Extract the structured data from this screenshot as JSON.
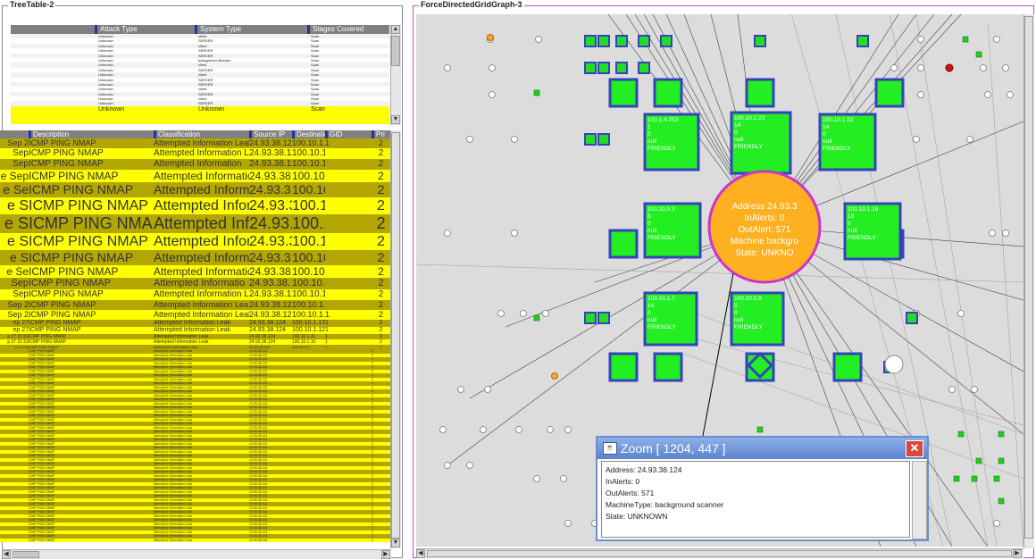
{
  "panels": {
    "left_title": "TreeTable-2",
    "right_title": "ForceDirectedGridGraph-3"
  },
  "top_table": {
    "headers": [
      "Attack Type",
      "System Type",
      "Stages Covered"
    ],
    "rows": [
      {
        "attack": "Unknown",
        "system": "client",
        "stages": "Scan"
      },
      {
        "attack": "Unknown",
        "system": "SERVER",
        "stages": "Scan"
      },
      {
        "attack": "Unknown",
        "system": "client",
        "stages": "Scan"
      },
      {
        "attack": "Unknown",
        "system": "SERVER",
        "stages": "Scan"
      },
      {
        "attack": "Unknown",
        "system": "SERVER",
        "stages": "Scan"
      },
      {
        "attack": "Unknown",
        "system": "background attacker",
        "stages": "Scan"
      },
      {
        "attack": "Unknown",
        "system": "client",
        "stages": "Scan"
      },
      {
        "attack": "Unknown",
        "system": "SERVER",
        "stages": "Scan"
      },
      {
        "attack": "Unknown",
        "system": "client",
        "stages": "Scan"
      },
      {
        "attack": "Unknown",
        "system": "SERVER",
        "stages": "Scan"
      },
      {
        "attack": "Unknown",
        "system": "SERVER",
        "stages": "Scan"
      },
      {
        "attack": "Unknown",
        "system": "client",
        "stages": "Scan"
      },
      {
        "attack": "Unknown",
        "system": "SERVER",
        "stages": "Scan"
      },
      {
        "attack": "Unknown",
        "system": "client",
        "stages": "Scan"
      },
      {
        "attack": "Unknown",
        "system": "SERVER",
        "stages": "Scan"
      },
      {
        "attack": "Unknown",
        "system": "Unknown",
        "stages": "Scan"
      }
    ]
  },
  "bottom_table": {
    "headers": [
      "Description",
      "Classification",
      "Source IP",
      "Destination",
      "GID",
      "Pri"
    ],
    "rows": [
      {
        "date": "Sep 2",
        "desc": "ICMP PING NMAP",
        "cls": "Attempted Information Leak",
        "src": "24.93.38.12",
        "dst": "100.10.1.1",
        "gid": "1",
        "pri": "2",
        "size": 9,
        "bg": "ol"
      },
      {
        "date": "Sep",
        "desc": "ICMP PING NMAP",
        "cls": "Attempted Information L",
        "src": "24.93.38.11",
        "dst": "100.10.1.21",
        "gid": "",
        "pri": "2",
        "size": 10,
        "bg": "yel"
      },
      {
        "date": "Sep",
        "desc": "ICMP PING NMAP",
        "cls": "Attempted Information",
        "src": "24.93.38.11",
        "dst": "100.10.1.31",
        "gid": "",
        "pri": "2",
        "size": 10,
        "bg": "ol"
      },
      {
        "date": "e Sep",
        "desc": "ICMP PING NMAP",
        "cls": "Attempted Informatio",
        "src": "24.93.38.",
        "dst": "100.10.1.1",
        "gid": "",
        "pri": "2",
        "size": 12,
        "bg": "yel"
      },
      {
        "date": "e Se",
        "desc": "ICMP PING NMAP",
        "cls": "Attempted Inform",
        "src": "24.93.3",
        "dst": "100.10.1",
        "gid": "",
        "pri": "2",
        "size": 14,
        "bg": "ol"
      },
      {
        "date": "e S",
        "desc": "ICMP PING NMAP",
        "cls": "Attempted Infor",
        "src": "24.93.3",
        "dst": "100.10.1",
        "gid": "",
        "pri": "2",
        "size": 16,
        "bg": "yel"
      },
      {
        "date": "e S",
        "desc": "ICMP PING NMAP",
        "cls": "Attempted Infor",
        "src": "24.93.3",
        "dst": "100.10.1",
        "gid": "",
        "pri": "2",
        "size": 18,
        "bg": "ol"
      },
      {
        "date": "e S",
        "desc": "ICMP PING NMAP",
        "cls": "Attempted Infor",
        "src": "24.93.3",
        "dst": "100.10.1",
        "gid": "",
        "pri": "2",
        "size": 16,
        "bg": "yel"
      },
      {
        "date": "e S",
        "desc": "ICMP PING NMAP",
        "cls": "Attempted Inform",
        "src": "24.93.3",
        "dst": "100.10.1",
        "gid": "",
        "pri": "2",
        "size": 14,
        "bg": "ol"
      },
      {
        "date": "e Se",
        "desc": "ICMP PING NMAP",
        "cls": "Attempted Informatio",
        "src": "24.93.38.",
        "dst": "100.10.1.1",
        "gid": "",
        "pri": "2",
        "size": 12,
        "bg": "yel"
      },
      {
        "date": "Sep",
        "desc": "ICMP PING NMAP",
        "cls": "Attempted Informatio",
        "src": "24.93.38.",
        "dst": "100.10.1.1",
        "gid": "",
        "pri": "2",
        "size": 11,
        "bg": "ol"
      },
      {
        "date": "Sep",
        "desc": "ICMP PING NMAP",
        "cls": "Attempted Information L",
        "src": "24.93.38.11",
        "dst": "100.10.1.11",
        "gid": "",
        "pri": "2",
        "size": 10,
        "bg": "yel"
      },
      {
        "date": "Sep 2",
        "desc": "ICMP PING NMAP",
        "cls": "Attempted Information Lea",
        "src": "24.93.38.12",
        "dst": "100.10.1.31",
        "gid": "",
        "pri": "2",
        "size": 9,
        "bg": "ol"
      },
      {
        "date": "Sep 2",
        "desc": "ICMP PING NMAP",
        "cls": "Attempted Information Leak",
        "src": "24.93.38.12",
        "dst": "100.10.1.14",
        "gid": "1",
        "pri": "2",
        "size": 9,
        "bg": "yel"
      },
      {
        "date": "ep 27",
        "desc": "ICMP PING NMAP",
        "cls": "Attempted Information Leak",
        "src": "24.93.38.124",
        "dst": "100.10.1.13",
        "gid": "1",
        "pri": "2",
        "size": 7,
        "bg": "ol"
      },
      {
        "date": "ep 27",
        "desc": "ICMP PING NMAP",
        "cls": "Attempted Information Leak",
        "src": "24.93.38.124",
        "dst": "100.10.1.12",
        "gid": "1",
        "pri": "2",
        "size": 7,
        "bg": "yel"
      },
      {
        "date": "p 27 21:53",
        "desc": "ICMP PING NMAP",
        "cls": "Attempted Information Leak",
        "src": "24.93.38.124",
        "dst": "100.10.1.11",
        "gid": "1",
        "pri": "2",
        "size": 5,
        "bg": "ol"
      },
      {
        "date": "p 27 21:53",
        "desc": "ICMP PING NMAP",
        "cls": "Attempted Information Leak",
        "src": "24.93.38.124",
        "dst": "100.10.1.10",
        "gid": "1",
        "pri": "2",
        "size": 5,
        "bg": "yel"
      },
      {
        "date": "27 21:53",
        "desc": "ICMP PING NMAP",
        "cls": "Attempted Information Leak",
        "src": "24.93.38.124",
        "dst": "100.10.1.9",
        "gid": "1",
        "pri": "2",
        "size": 4,
        "bg": "ol"
      }
    ],
    "tiny_desc": "ICMP PING NMAP",
    "tiny_cls": "Attempted Information Leak",
    "tiny_src": "24.93.38.124",
    "tiny_pri": "2"
  },
  "graph": {
    "hub": {
      "lines": [
        "Address 24.93.3",
        "InAlerts: 0",
        "OutAlert: 571",
        "Machine backgro",
        "State: UNKNO"
      ]
    },
    "boxes": [
      {
        "lines": [
          "100.1.4.253",
          "1",
          "0",
          "null",
          "FRIENDLY"
        ]
      },
      {
        "lines": [
          "100.10.1.23",
          "14",
          "0",
          "null",
          "FRIENDLY"
        ]
      },
      {
        "lines": [
          "100.10.1.22",
          "14",
          "0",
          "null",
          "FRIENDLY"
        ]
      },
      {
        "lines": [
          "100.20.5.3",
          "5",
          "0",
          "null",
          "FRIENDLY"
        ]
      },
      {
        "lines": [
          "100.10.1.16",
          "13",
          "0",
          "null",
          "FRIENDLY"
        ]
      },
      {
        "lines": [
          "100.10.1.7",
          "14",
          "0",
          "null",
          "FRIENDLY"
        ]
      },
      {
        "lines": [
          "100.20.5.9",
          "5",
          "0",
          "null",
          "FRIENDLY"
        ]
      }
    ]
  },
  "zoom": {
    "title": "Zoom [ 1204, 447 ]",
    "window_icon": "java-icon",
    "close_icon": "close-icon",
    "lines": [
      "Address: 24.93.38.124",
      "InAlerts: 0",
      "OutAlerts: 571",
      "MachineType: background scanner",
      "State: UNKNOWN"
    ]
  }
}
